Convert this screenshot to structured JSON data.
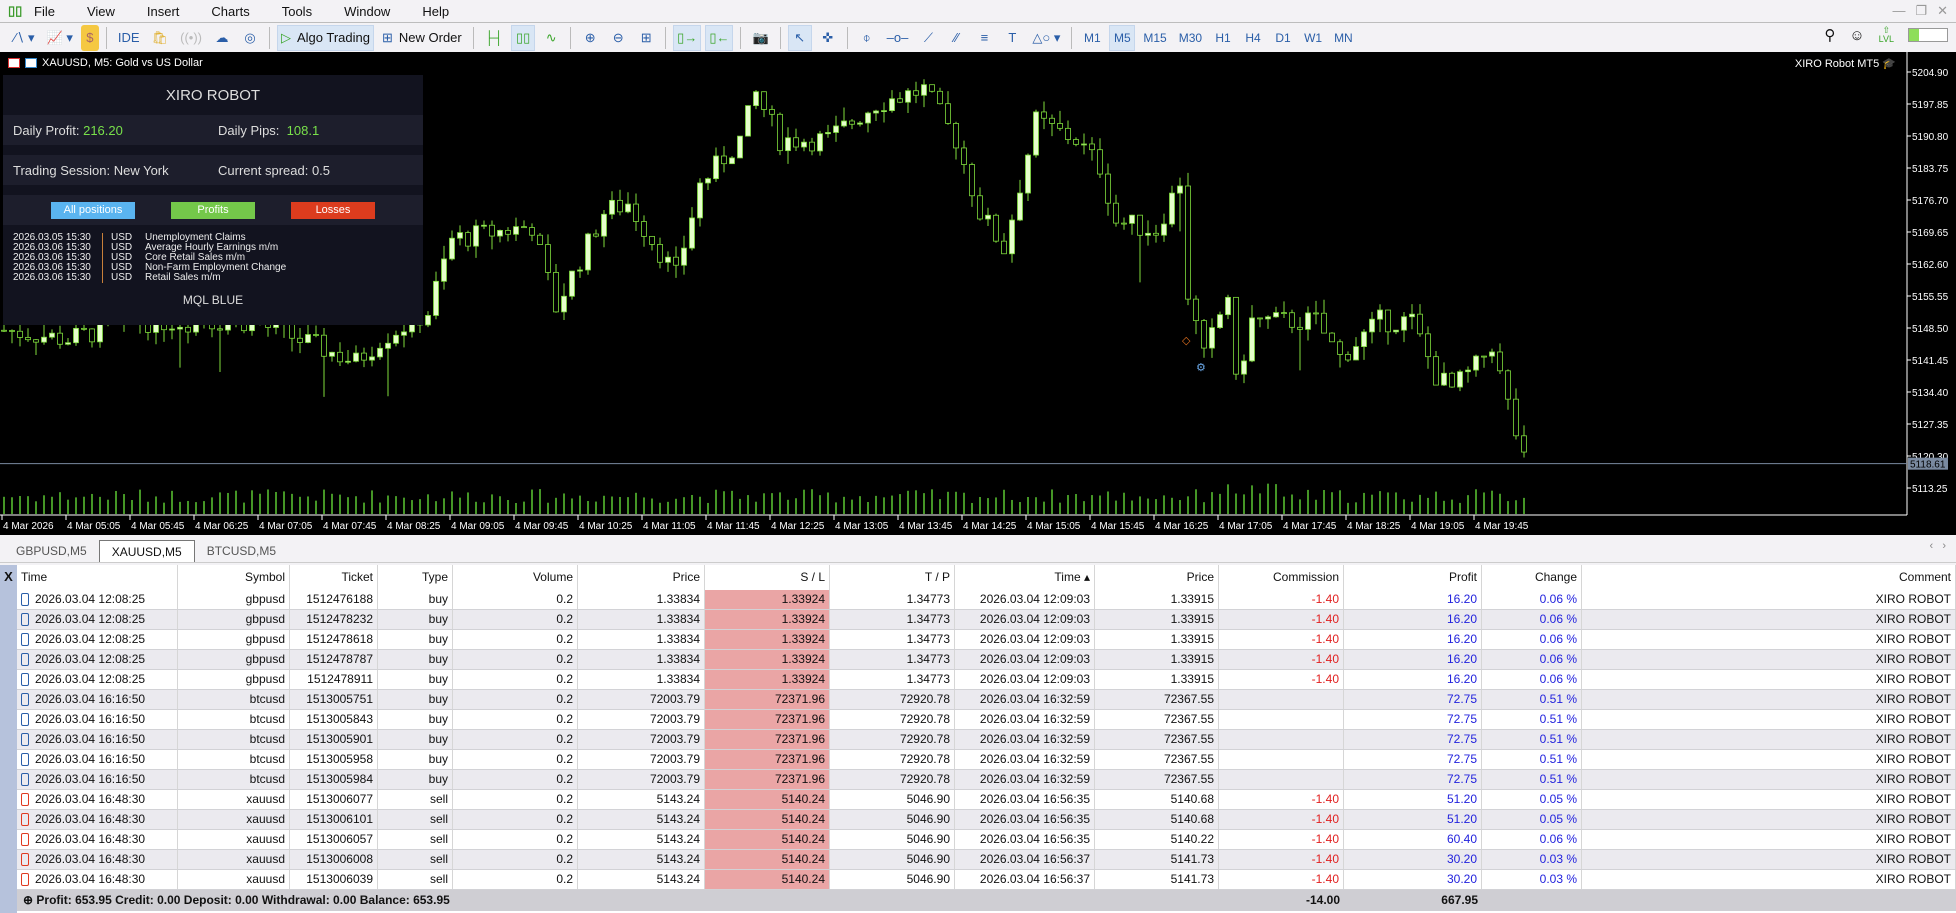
{
  "menu": {
    "items": [
      "File",
      "View",
      "Insert",
      "Charts",
      "Tools",
      "Window",
      "Help"
    ]
  },
  "toolbar": {
    "ide_label": "IDE",
    "algo_trading_label": "Algo Trading",
    "new_order_label": "New Order",
    "timeframes": [
      "M1",
      "M5",
      "M15",
      "M30",
      "H1",
      "H4",
      "D1",
      "W1",
      "MN"
    ],
    "active_timeframe": "M5",
    "lvl_label": "LVL",
    "lvl_progress": 0.25
  },
  "chart": {
    "title": "XAUUSD, M5:  Gold vs US Dollar",
    "ea_label": "XIRO Robot MT5",
    "bid_price": "5118.61",
    "colors": {
      "bull": "#e6ffcc",
      "wick": "#7fdc3c",
      "volume": "#5cc832",
      "bid_line": "#7a8aa0"
    }
  },
  "chart_data": {
    "type": "candlestick",
    "symbol": "XAUUSD",
    "timeframe": "M5",
    "ylim": [
      5108,
      5210
    ],
    "y_ticks": [
      "5204.90",
      "5197.85",
      "5190.80",
      "5183.75",
      "5176.70",
      "5169.65",
      "5162.60",
      "5155.55",
      "5148.50",
      "5141.45",
      "5134.40",
      "5127.35",
      "5120.30",
      "5113.25"
    ],
    "x_ticks": [
      "4 Mar 2026",
      "4 Mar 05:05",
      "4 Mar 05:45",
      "4 Mar 06:25",
      "4 Mar 07:05",
      "4 Mar 07:45",
      "4 Mar 08:25",
      "4 Mar 09:05",
      "4 Mar 09:45",
      "4 Mar 10:25",
      "4 Mar 11:05",
      "4 Mar 11:45",
      "4 Mar 12:25",
      "4 Mar 13:05",
      "4 Mar 13:45",
      "4 Mar 14:25",
      "4 Mar 15:05",
      "4 Mar 15:45",
      "4 Mar 16:25",
      "4 Mar 17:05",
      "4 Mar 17:45",
      "4 Mar 18:25",
      "4 Mar 19:05",
      "4 Mar 19:45"
    ],
    "bars_count": 191,
    "close_waypoints": [
      [
        0,
        5148
      ],
      [
        8,
        5146
      ],
      [
        16,
        5150
      ],
      [
        31,
        5150
      ],
      [
        44,
        5141
      ],
      [
        47,
        5146
      ],
      [
        53,
        5152
      ],
      [
        56,
        5168
      ],
      [
        66,
        5171
      ],
      [
        69,
        5153
      ],
      [
        75,
        5174
      ],
      [
        78,
        5176
      ],
      [
        84,
        5160
      ],
      [
        87,
        5180
      ],
      [
        92,
        5190
      ],
      [
        94,
        5200
      ],
      [
        97,
        5190
      ],
      [
        103,
        5190
      ],
      [
        109,
        5198
      ],
      [
        115,
        5201
      ],
      [
        119,
        5190
      ],
      [
        122,
        5174
      ],
      [
        125,
        5166
      ],
      [
        129,
        5194
      ],
      [
        134,
        5190
      ],
      [
        137,
        5184
      ],
      [
        139,
        5172
      ],
      [
        144,
        5170
      ],
      [
        147,
        5181
      ],
      [
        148,
        5156
      ],
      [
        150,
        5142
      ],
      [
        153,
        5156
      ],
      [
        154,
        5136
      ],
      [
        156,
        5150
      ],
      [
        159,
        5150
      ],
      [
        164,
        5150
      ],
      [
        167,
        5142
      ],
      [
        172,
        5150
      ],
      [
        176,
        5150
      ],
      [
        179,
        5138
      ],
      [
        181,
        5135
      ],
      [
        184,
        5140
      ],
      [
        186,
        5145
      ],
      [
        187,
        5138
      ],
      [
        190,
        5119
      ]
    ]
  },
  "panel": {
    "title": "XIRO ROBOT",
    "daily_profit_label": "Daily Profit:",
    "daily_profit": "216.20",
    "daily_pips_label": "Daily Pips:",
    "daily_pips": "108.1",
    "session_label": "Trading Session:",
    "session": "New York",
    "spread_label": "Current spread:",
    "spread": "0.5",
    "buttons": [
      {
        "label": "All positions",
        "color": "#5ab4f0"
      },
      {
        "label": "Profits",
        "color": "#74c84a"
      },
      {
        "label": "Losses",
        "color": "#dc3c1e"
      }
    ],
    "news": [
      {
        "date": "2026.03.05 15:30",
        "currency": "USD",
        "event": "Unemployment Claims"
      },
      {
        "date": "2026.03.06 15:30",
        "currency": "USD",
        "event": "Average Hourly Earnings m/m"
      },
      {
        "date": "2026.03.06 15:30",
        "currency": "USD",
        "event": "Core Retail Sales m/m"
      },
      {
        "date": "2026.03.06 15:30",
        "currency": "USD",
        "event": "Non-Farm Employment Change"
      },
      {
        "date": "2026.03.06 15:30",
        "currency": "USD",
        "event": "Retail Sales m/m"
      }
    ],
    "footer": "MQL BLUE"
  },
  "tabs": [
    "GBPUSD,M5",
    "XAUUSD,M5",
    "BTCUSD,M5"
  ],
  "active_tab": 1,
  "table": {
    "close_label": "X",
    "columns": [
      "Time",
      "Symbol",
      "Ticket",
      "Type",
      "Volume",
      "Price",
      "S / L",
      "T / P",
      "Time ▴",
      "Price",
      "Commission",
      "Profit",
      "Change",
      "Comment"
    ],
    "rows": [
      [
        "2026.03.04 12:08:25",
        "gbpusd",
        "1512476188",
        "buy",
        "0.2",
        "1.33834",
        "1.33924",
        "1.34773",
        "2026.03.04 12:09:03",
        "1.33915",
        "-1.40",
        "16.20",
        "0.06 %",
        "XIRO ROBOT"
      ],
      [
        "2026.03.04 12:08:25",
        "gbpusd",
        "1512478232",
        "buy",
        "0.2",
        "1.33834",
        "1.33924",
        "1.34773",
        "2026.03.04 12:09:03",
        "1.33915",
        "-1.40",
        "16.20",
        "0.06 %",
        "XIRO ROBOT"
      ],
      [
        "2026.03.04 12:08:25",
        "gbpusd",
        "1512478618",
        "buy",
        "0.2",
        "1.33834",
        "1.33924",
        "1.34773",
        "2026.03.04 12:09:03",
        "1.33915",
        "-1.40",
        "16.20",
        "0.06 %",
        "XIRO ROBOT"
      ],
      [
        "2026.03.04 12:08:25",
        "gbpusd",
        "1512478787",
        "buy",
        "0.2",
        "1.33834",
        "1.33924",
        "1.34773",
        "2026.03.04 12:09:03",
        "1.33915",
        "-1.40",
        "16.20",
        "0.06 %",
        "XIRO ROBOT"
      ],
      [
        "2026.03.04 12:08:25",
        "gbpusd",
        "1512478911",
        "buy",
        "0.2",
        "1.33834",
        "1.33924",
        "1.34773",
        "2026.03.04 12:09:03",
        "1.33915",
        "-1.40",
        "16.20",
        "0.06 %",
        "XIRO ROBOT"
      ],
      [
        "2026.03.04 16:16:50",
        "btcusd",
        "1513005751",
        "buy",
        "0.2",
        "72003.79",
        "72371.96",
        "72920.78",
        "2026.03.04 16:32:59",
        "72367.55",
        "",
        "72.75",
        "0.51 %",
        "XIRO ROBOT"
      ],
      [
        "2026.03.04 16:16:50",
        "btcusd",
        "1513005843",
        "buy",
        "0.2",
        "72003.79",
        "72371.96",
        "72920.78",
        "2026.03.04 16:32:59",
        "72367.55",
        "",
        "72.75",
        "0.51 %",
        "XIRO ROBOT"
      ],
      [
        "2026.03.04 16:16:50",
        "btcusd",
        "1513005901",
        "buy",
        "0.2",
        "72003.79",
        "72371.96",
        "72920.78",
        "2026.03.04 16:32:59",
        "72367.55",
        "",
        "72.75",
        "0.51 %",
        "XIRO ROBOT"
      ],
      [
        "2026.03.04 16:16:50",
        "btcusd",
        "1513005958",
        "buy",
        "0.2",
        "72003.79",
        "72371.96",
        "72920.78",
        "2026.03.04 16:32:59",
        "72367.55",
        "",
        "72.75",
        "0.51 %",
        "XIRO ROBOT"
      ],
      [
        "2026.03.04 16:16:50",
        "btcusd",
        "1513005984",
        "buy",
        "0.2",
        "72003.79",
        "72371.96",
        "72920.78",
        "2026.03.04 16:32:59",
        "72367.55",
        "",
        "72.75",
        "0.51 %",
        "XIRO ROBOT"
      ],
      [
        "2026.03.04 16:48:30",
        "xauusd",
        "1513006077",
        "sell",
        "0.2",
        "5143.24",
        "5140.24",
        "5046.90",
        "2026.03.04 16:56:35",
        "5140.68",
        "-1.40",
        "51.20",
        "0.05 %",
        "XIRO ROBOT"
      ],
      [
        "2026.03.04 16:48:30",
        "xauusd",
        "1513006101",
        "sell",
        "0.2",
        "5143.24",
        "5140.24",
        "5046.90",
        "2026.03.04 16:56:35",
        "5140.68",
        "-1.40",
        "51.20",
        "0.05 %",
        "XIRO ROBOT"
      ],
      [
        "2026.03.04 16:48:30",
        "xauusd",
        "1513006057",
        "sell",
        "0.2",
        "5143.24",
        "5140.24",
        "5046.90",
        "2026.03.04 16:56:35",
        "5140.22",
        "-1.40",
        "60.40",
        "0.06 %",
        "XIRO ROBOT"
      ],
      [
        "2026.03.04 16:48:30",
        "xauusd",
        "1513006008",
        "sell",
        "0.2",
        "5143.24",
        "5140.24",
        "5046.90",
        "2026.03.04 16:56:37",
        "5141.73",
        "-1.40",
        "30.20",
        "0.03 %",
        "XIRO ROBOT"
      ],
      [
        "2026.03.04 16:48:30",
        "xauusd",
        "1513006039",
        "sell",
        "0.2",
        "5143.24",
        "5140.24",
        "5046.90",
        "2026.03.04 16:56:37",
        "5141.73",
        "-1.40",
        "30.20",
        "0.03 %",
        "XIRO ROBOT"
      ]
    ],
    "footer": {
      "summary": "Profit: 653.95  Credit: 0.00  Deposit: 0.00  Withdrawal: 0.00  Balance: 653.95",
      "commission_total": "-14.00",
      "profit_total": "667.95"
    }
  }
}
